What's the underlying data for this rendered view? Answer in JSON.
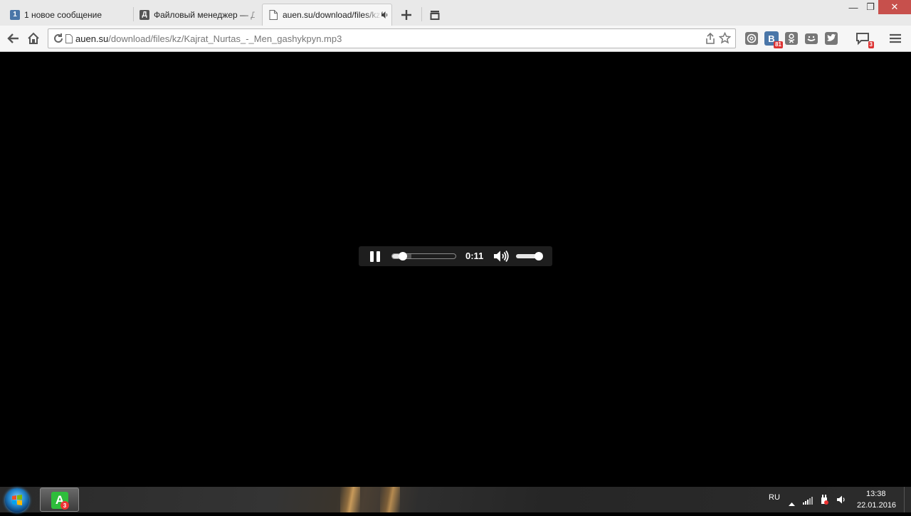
{
  "tabs": [
    {
      "title": "1 новое сообщение",
      "favicon": "1",
      "favicon_color": "#4a76a8",
      "active": false
    },
    {
      "title": "Файловый менеджер — Джо",
      "favicon": "Д",
      "favicon_color": "#555555",
      "active": false
    },
    {
      "title": "auen.su/download/files/kz/",
      "favicon": "page-icon",
      "active": true,
      "audio": "speaker-icon"
    }
  ],
  "window": {
    "minimize": "—",
    "restore": "❐",
    "close": "✕"
  },
  "omnibox": {
    "host": "auen.su",
    "path": "/download/files/kz/Kajrat_Nurtas_-_Men_gashykpyn.mp3"
  },
  "extensions": [
    {
      "name": "mail-at-icon",
      "badge": ""
    },
    {
      "name": "vk-icon",
      "label": "В",
      "badge": "81"
    },
    {
      "name": "odnoklassniki-icon",
      "badge": ""
    },
    {
      "name": "smiley-box-icon",
      "badge": ""
    },
    {
      "name": "twitter-icon",
      "badge": ""
    },
    {
      "name": "chat-icon",
      "badge": "3"
    }
  ],
  "player": {
    "state": "playing",
    "time": "0:11",
    "progress_fraction": 0.12,
    "buffered_fraction": 0.3,
    "volume_fraction": 1.0
  },
  "taskbar": {
    "app_letter": "A",
    "app_badge": "3",
    "language": "RU",
    "clock_time": "13:38",
    "clock_date": "22.01.2016"
  },
  "colors": {
    "accent_close": "#c7504c",
    "badge_red": "#dd3333",
    "app_green": "#2ebd3b"
  }
}
